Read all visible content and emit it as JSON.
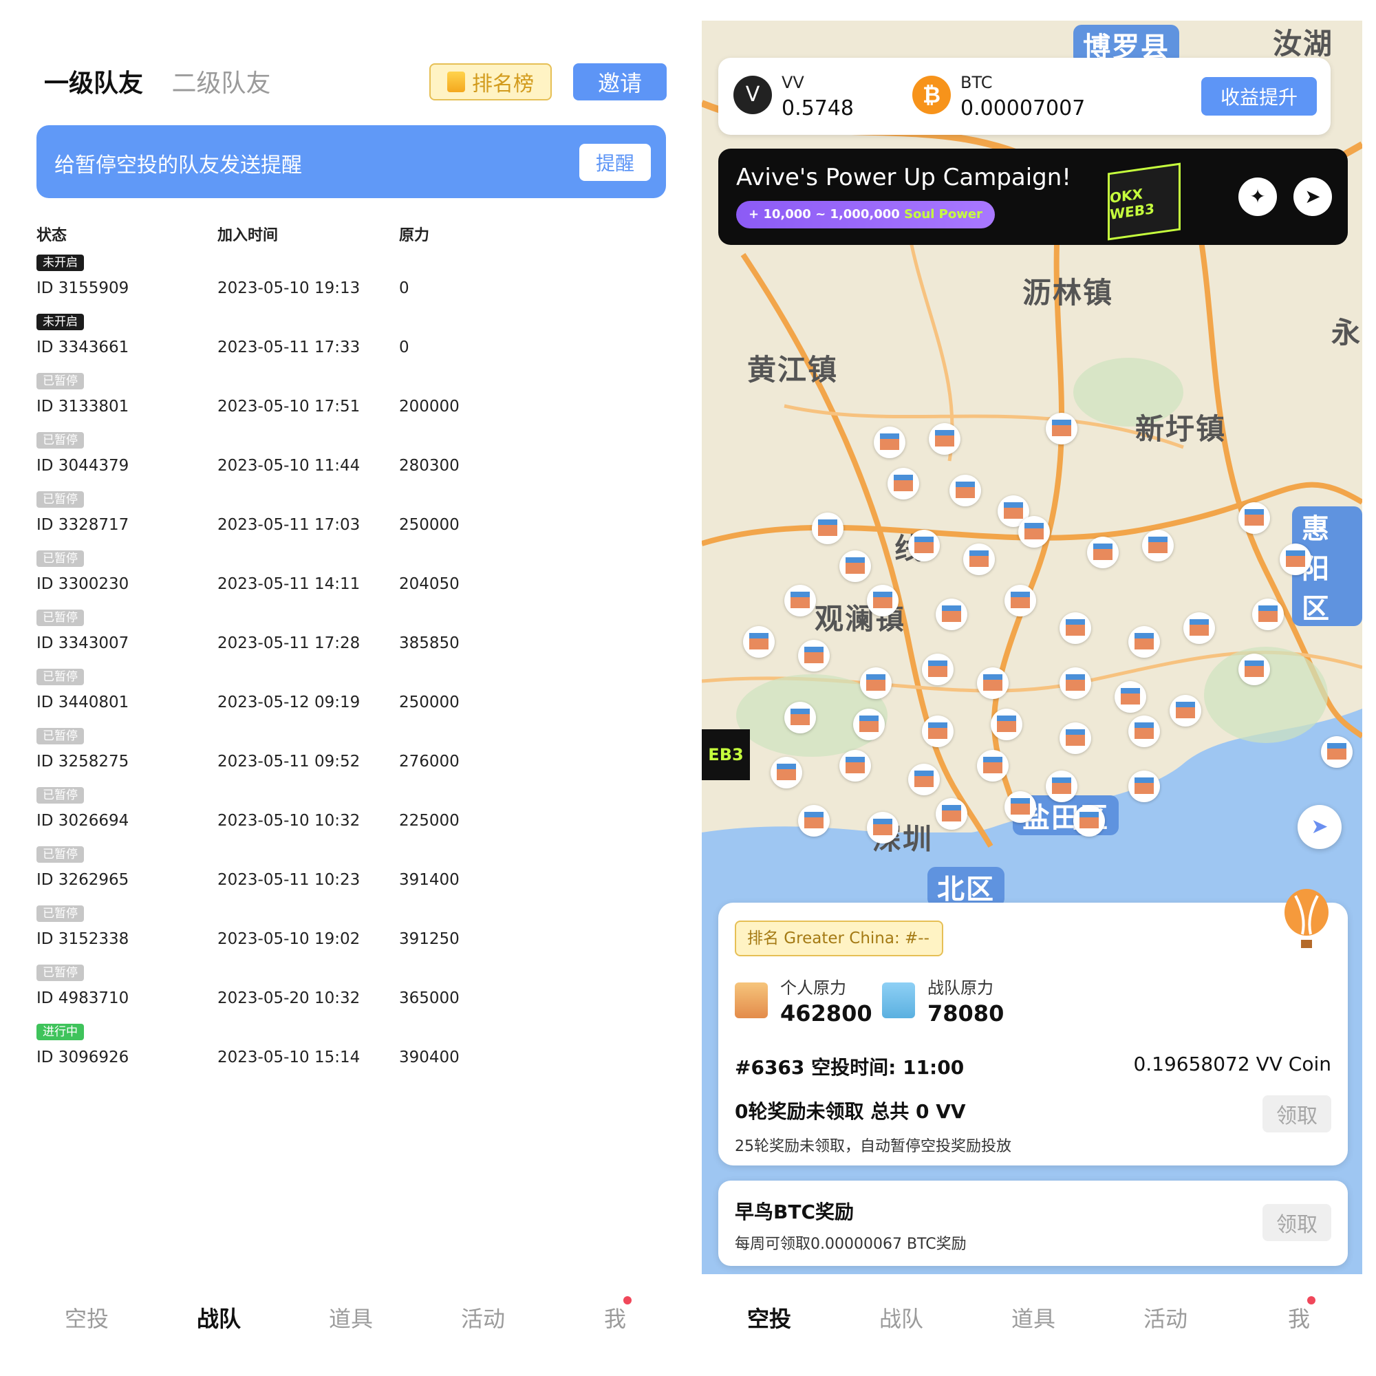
{
  "left": {
    "tabs": [
      {
        "label": "一级队友",
        "active": true
      },
      {
        "label": "二级队友",
        "active": false
      }
    ],
    "rank_button": "排名榜",
    "invite_button": "邀请",
    "remind_banner": {
      "text": "给暂停空投的队友发送提醒",
      "button": "提醒"
    },
    "columns": [
      "状态",
      "加入时间",
      "原力"
    ],
    "rows": [
      {
        "status": "未开启",
        "status_type": "off",
        "id": "ID 3155909",
        "joined": "2023-05-10 19:13",
        "power": "0"
      },
      {
        "status": "未开启",
        "status_type": "off",
        "id": "ID 3343661",
        "joined": "2023-05-11 17:33",
        "power": "0"
      },
      {
        "status": "已暂停",
        "status_type": "paused",
        "id": "ID 3133801",
        "joined": "2023-05-10 17:51",
        "power": "200000"
      },
      {
        "status": "已暂停",
        "status_type": "paused",
        "id": "ID 3044379",
        "joined": "2023-05-10 11:44",
        "power": "280300"
      },
      {
        "status": "已暂停",
        "status_type": "paused",
        "id": "ID 3328717",
        "joined": "2023-05-11 17:03",
        "power": "250000"
      },
      {
        "status": "已暂停",
        "status_type": "paused",
        "id": "ID 3300230",
        "joined": "2023-05-11 14:11",
        "power": "204050"
      },
      {
        "status": "已暂停",
        "status_type": "paused",
        "id": "ID 3343007",
        "joined": "2023-05-11 17:28",
        "power": "385850"
      },
      {
        "status": "已暂停",
        "status_type": "paused",
        "id": "ID 3440801",
        "joined": "2023-05-12 09:19",
        "power": "250000"
      },
      {
        "status": "已暂停",
        "status_type": "paused",
        "id": "ID 3258275",
        "joined": "2023-05-11 09:52",
        "power": "276000"
      },
      {
        "status": "已暂停",
        "status_type": "paused",
        "id": "ID 3026694",
        "joined": "2023-05-10 10:32",
        "power": "225000"
      },
      {
        "status": "已暂停",
        "status_type": "paused",
        "id": "ID 3262965",
        "joined": "2023-05-11 10:23",
        "power": "391400"
      },
      {
        "status": "已暂停",
        "status_type": "paused",
        "id": "ID 3152338",
        "joined": "2023-05-10 19:02",
        "power": "391250"
      },
      {
        "status": "已暂停",
        "status_type": "paused",
        "id": "ID 4983710",
        "joined": "2023-05-20 10:32",
        "power": "365000"
      },
      {
        "status": "进行中",
        "status_type": "active",
        "id": "ID 3096926",
        "joined": "2023-05-10 15:14",
        "power": "390400"
      }
    ],
    "bottom_nav": [
      {
        "label": "空投",
        "active": false
      },
      {
        "label": "战队",
        "active": true
      },
      {
        "label": "道具",
        "active": false
      },
      {
        "label": "活动",
        "active": false
      },
      {
        "label": "我",
        "active": false,
        "badge": true
      }
    ]
  },
  "right": {
    "wallet": {
      "vv_name": "VV",
      "vv_value": "0.5748",
      "btc_name": "BTC",
      "btc_value": "0.00007007",
      "boost_button": "收益提升"
    },
    "campaign": {
      "title": "Avive's Power Up Campaign!",
      "pill_prefix": "+ 10,000 ~ 1,000,000",
      "pill_highlight": "Soul Power",
      "cube_text": "OKX WEB3",
      "icons": [
        "twitter-icon",
        "telegram-icon"
      ]
    },
    "map_labels": [
      "博罗县",
      "汝湖镇",
      "沥林镇",
      "永",
      "黄江镇",
      "新圩镇",
      "惠阳区",
      "观澜镇",
      "线",
      "盐田区",
      "深圳",
      "北区"
    ],
    "okx_badge": "EB3",
    "stats": {
      "rank_chip": "排名 Greater China: #--",
      "personal_label": "个人原力",
      "personal_value": "462800",
      "team_label": "战队原力",
      "team_value": "78080",
      "drop_line": "#6363 空投时间: 11:00",
      "coin_line": "0.19658072 VV Coin",
      "reward_title": "0轮奖励未领取 总共 0 VV",
      "reward_sub": "25轮奖励未领取，自动暂停空投奖励投放",
      "claim_button": "领取"
    },
    "btc_reward": {
      "title": "早鸟BTC奖励",
      "sub": "每周可领取0.00000067 BTC奖励",
      "claim_button": "领取"
    },
    "bottom_nav": [
      {
        "label": "空投",
        "active": true
      },
      {
        "label": "战队",
        "active": false
      },
      {
        "label": "道具",
        "active": false
      },
      {
        "label": "活动",
        "active": false
      },
      {
        "label": "我",
        "active": false,
        "badge": true
      }
    ]
  },
  "colors": {
    "accent_blue": "#5d95f6",
    "gold": "#e6bf55",
    "active_green": "#3fc35b",
    "badge_red": "#f0475a"
  }
}
